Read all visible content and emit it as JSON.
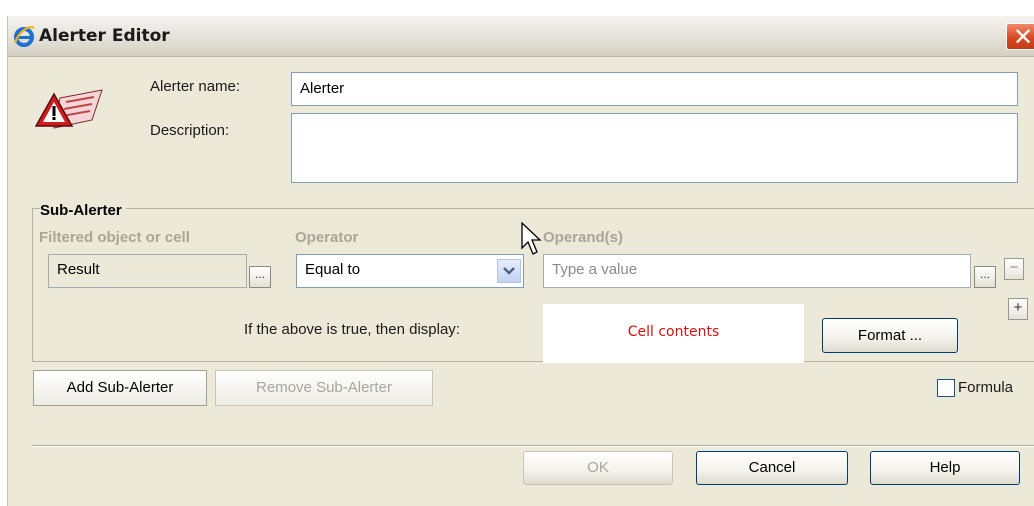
{
  "window": {
    "title": "Alerter Editor",
    "close_symbol": "✕",
    "title_icon": "internet-explorer-icon"
  },
  "header": {
    "alerter_icon": "alerter-warning-icon",
    "name_label": "Alerter name:",
    "name_value": "Alerter",
    "description_label": "Description:",
    "description_value": ""
  },
  "sub_alerter": {
    "title": "Sub-Alerter",
    "columns": {
      "filtered": "Filtered object or cell",
      "operator": "Operator",
      "operands": "Operand(s)"
    },
    "filtered_value": "Result",
    "ellipsis": "...",
    "operator_value": "Equal to",
    "operand_placeholder": "Type a value",
    "remove_operand": "−",
    "add_operand": "+",
    "display_label": "If the above is true, then display:",
    "display_preview": "Cell contents",
    "format_button": "Format ..."
  },
  "actions": {
    "add_sub_alerter": "Add Sub-Alerter",
    "remove_sub_alerter": "Remove Sub-Alerter",
    "formula_label": "Formula",
    "formula_checked": false
  },
  "footer": {
    "ok": "OK",
    "cancel": "Cancel",
    "help": "Help"
  },
  "colors": {
    "dialog_bg": "#ece9d8",
    "close_button": "#d4461f",
    "preview_text": "#d41010",
    "disabled_text": "#a8a698"
  }
}
